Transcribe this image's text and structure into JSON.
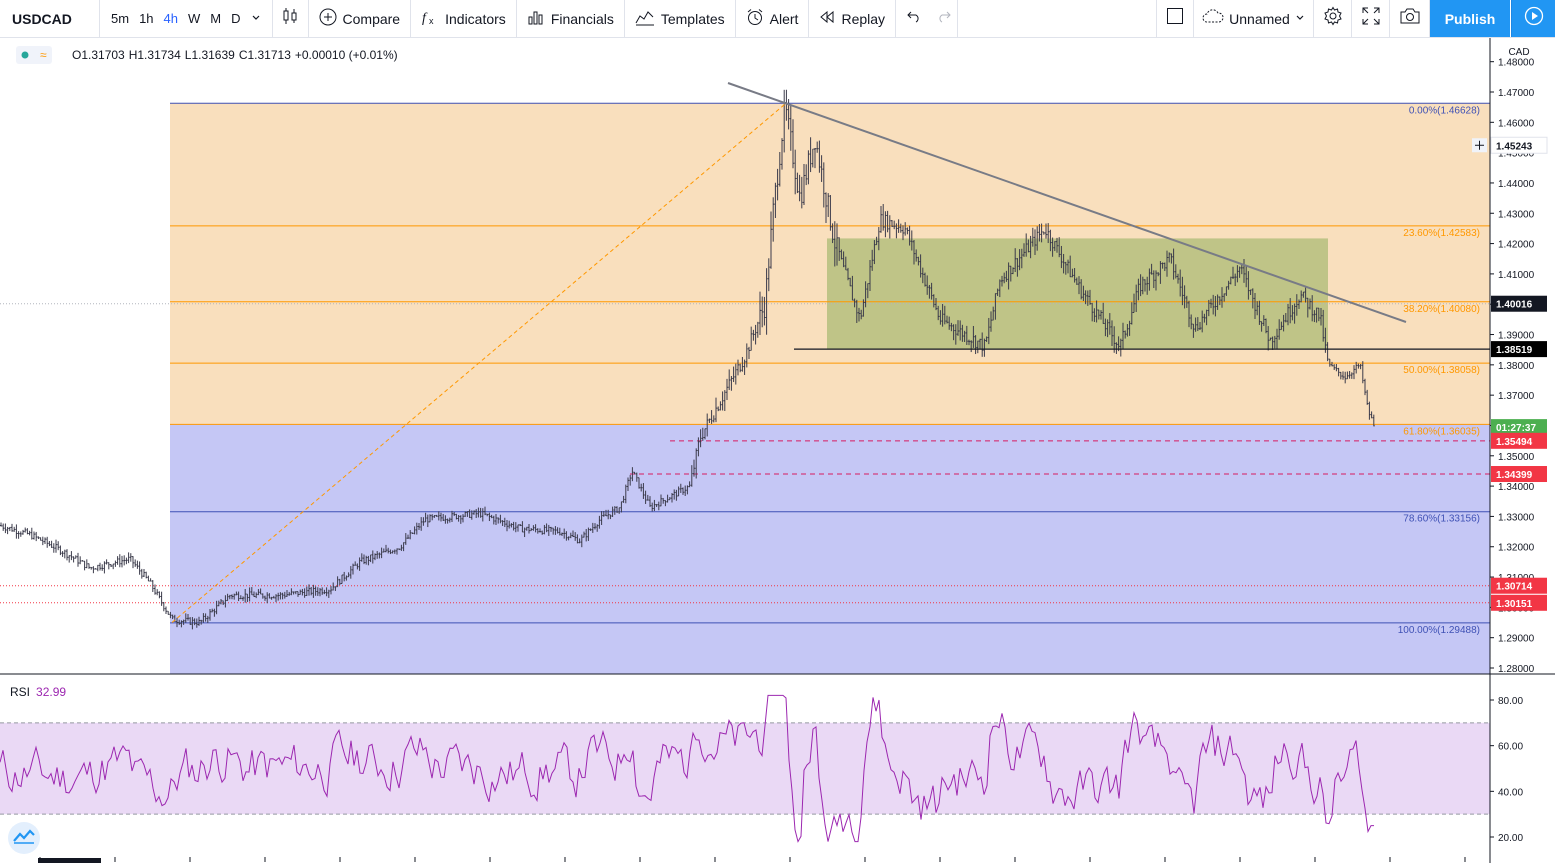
{
  "toolbar": {
    "symbol": "USDCAD",
    "timeframes": [
      "5m",
      "1h",
      "4h",
      "W",
      "M",
      "D"
    ],
    "active_timeframe": "4h",
    "compare_label": "Compare",
    "indicators_label": "Indicators",
    "financials_label": "Financials",
    "templates_label": "Templates",
    "alert_label": "Alert",
    "replay_label": "Replay",
    "layout_name": "Unnamed",
    "publish_label": "Publish"
  },
  "legend": {
    "open": "O1.31703",
    "high": "H1.31734",
    "low": "L1.31639",
    "close": "C1.31713",
    "change": "+0.00010 (+0.01%)"
  },
  "price_axis": {
    "currency": "CAD",
    "ticks": [
      "1.48000",
      "1.47000",
      "1.46000",
      "1.45000",
      "1.44000",
      "1.43000",
      "1.42000",
      "1.41000",
      "1.40000",
      "1.39000",
      "1.38000",
      "1.37000",
      "1.36000",
      "1.35000",
      "1.34000",
      "1.33000",
      "1.32000",
      "1.31000",
      "1.30000",
      "1.29000",
      "1.28000"
    ]
  },
  "price_labels": [
    {
      "text": "1.45243",
      "price": 1.45243,
      "bg": "#ffffff",
      "fg": "#131722"
    },
    {
      "text": "1.40016",
      "price": 1.40016,
      "bg": "#131722",
      "fg": "#ffffff"
    },
    {
      "text": "1.38519",
      "price": 1.38519,
      "bg": "#000000",
      "fg": "#ffffff"
    },
    {
      "text": "01:27:37",
      "price": 1.35946,
      "bg": "#4caf50",
      "fg": "#ffffff"
    },
    {
      "text": "1.35494",
      "price": 1.35494,
      "bg": "#f23645",
      "fg": "#ffffff"
    },
    {
      "text": "1.34399",
      "price": 1.34399,
      "bg": "#f23645",
      "fg": "#ffffff"
    },
    {
      "text": "1.30714",
      "price": 1.30714,
      "bg": "#f23645",
      "fg": "#ffffff"
    },
    {
      "text": "1.30151",
      "price": 1.30151,
      "bg": "#f23645",
      "fg": "#ffffff"
    }
  ],
  "fib_levels": [
    {
      "label": "0.00%(1.46628)",
      "price": 1.46628,
      "color": "#3f51b5"
    },
    {
      "label": "23.60%(1.42583)",
      "price": 1.42583,
      "color": "#ff9800"
    },
    {
      "label": "38.20%(1.40080)",
      "price": 1.4008,
      "color": "#ff9800"
    },
    {
      "label": "50.00%(1.38058)",
      "price": 1.38058,
      "color": "#ff9800"
    },
    {
      "label": "61.80%(1.36035)",
      "price": 1.36035,
      "color": "#ff9800"
    },
    {
      "label": "78.60%(1.33156)",
      "price": 1.33156,
      "color": "#3f51b5"
    },
    {
      "label": "100.00%(1.29488)",
      "price": 1.29488,
      "color": "#3f51b5"
    }
  ],
  "rsi": {
    "label": "RSI",
    "value": "32.99",
    "ticks": [
      "80.00",
      "60.00",
      "40.00",
      "20.00"
    ],
    "upper_band": 70,
    "lower_band": 30
  },
  "colors": {
    "fib_orange_zone": "#f9dfbd",
    "fib_blue_zone": "#c5c7f5",
    "consolidation_box": "#b5c07e",
    "rsi_line": "#9c27b0",
    "rsi_band": "#ead9f5",
    "accent": "#2196f3"
  }
}
